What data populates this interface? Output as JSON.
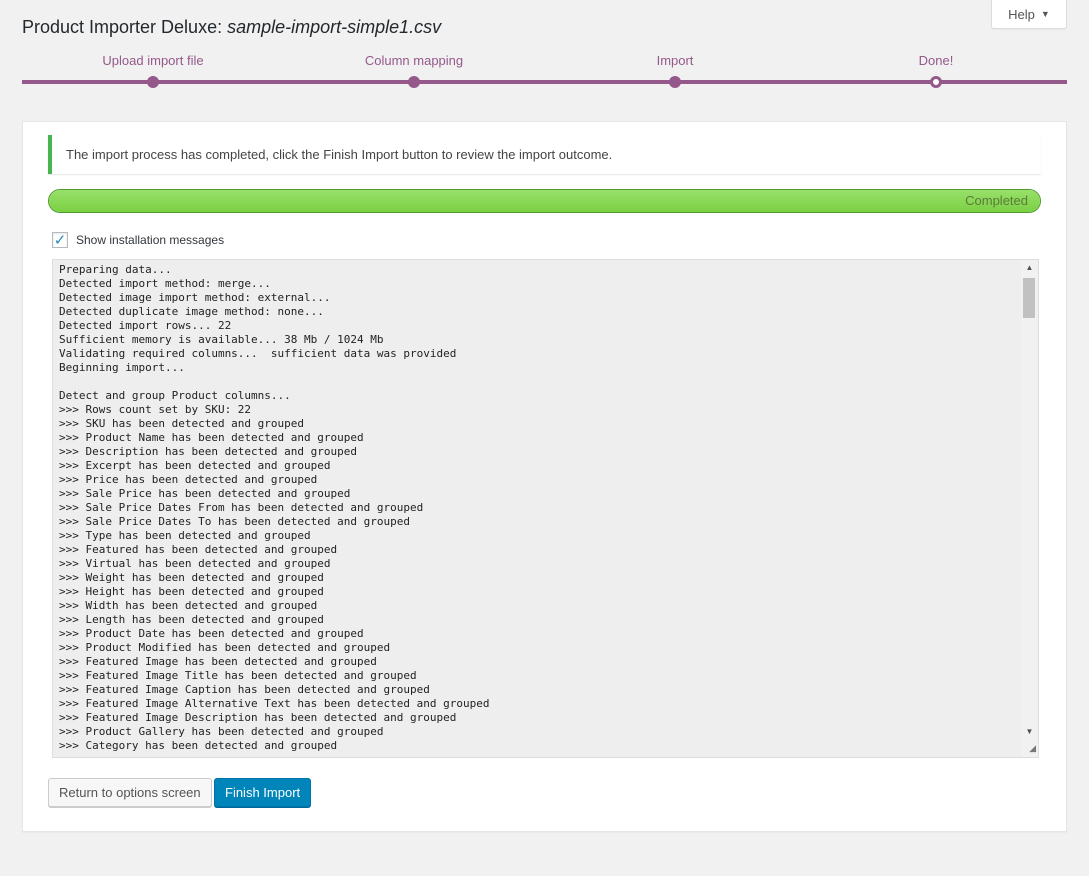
{
  "help": {
    "label": "Help"
  },
  "page": {
    "title_prefix": "Product Importer Deluxe: ",
    "filename": "sample-import-simple1.csv"
  },
  "steps": [
    {
      "label": "Upload import file",
      "state": "done"
    },
    {
      "label": "Column mapping",
      "state": "done"
    },
    {
      "label": "Import",
      "state": "done"
    },
    {
      "label": "Done!",
      "state": "current"
    }
  ],
  "notice": {
    "text": "The import process has completed, click the Finish Import button to review the import outcome."
  },
  "progress": {
    "percent": 100,
    "label": "Completed"
  },
  "show_messages": {
    "label": "Show installation messages",
    "checked": true
  },
  "log_lines": [
    "Preparing data...",
    "Detected import method: merge...",
    "Detected image import method: external...",
    "Detected duplicate image method: none...",
    "Detected import rows... 22",
    "Sufficient memory is available... 38 Mb / 1024 Mb",
    "Validating required columns...  sufficient data was provided",
    "Beginning import...",
    "",
    "Detect and group Product columns...",
    ">>> Rows count set by SKU: 22",
    ">>> SKU has been detected and grouped",
    ">>> Product Name has been detected and grouped",
    ">>> Description has been detected and grouped",
    ">>> Excerpt has been detected and grouped",
    ">>> Price has been detected and grouped",
    ">>> Sale Price has been detected and grouped",
    ">>> Sale Price Dates From has been detected and grouped",
    ">>> Sale Price Dates To has been detected and grouped",
    ">>> Type has been detected and grouped",
    ">>> Featured has been detected and grouped",
    ">>> Virtual has been detected and grouped",
    ">>> Weight has been detected and grouped",
    ">>> Height has been detected and grouped",
    ">>> Width has been detected and grouped",
    ">>> Length has been detected and grouped",
    ">>> Product Date has been detected and grouped",
    ">>> Product Modified has been detected and grouped",
    ">>> Featured Image has been detected and grouped",
    ">>> Featured Image Title has been detected and grouped",
    ">>> Featured Image Caption has been detected and grouped",
    ">>> Featured Image Alternative Text has been detected and grouped",
    ">>> Featured Image Description has been detected and grouped",
    ">>> Product Gallery has been detected and grouped",
    ">>> Category has been detected and grouped"
  ],
  "buttons": {
    "return_label": "Return to options screen",
    "finish_label": "Finish Import"
  },
  "colors": {
    "accent": "#95588a",
    "success": "#46b450",
    "progress_fill": "#7bd044",
    "primary_button": "#0085ba"
  },
  "icons": {
    "help_caret": "caret-down-icon",
    "checkbox": "checkmark-icon",
    "scroll_up": "arrow-up-icon",
    "scroll_down": "arrow-down-icon",
    "resize": "resize-grip-icon"
  }
}
